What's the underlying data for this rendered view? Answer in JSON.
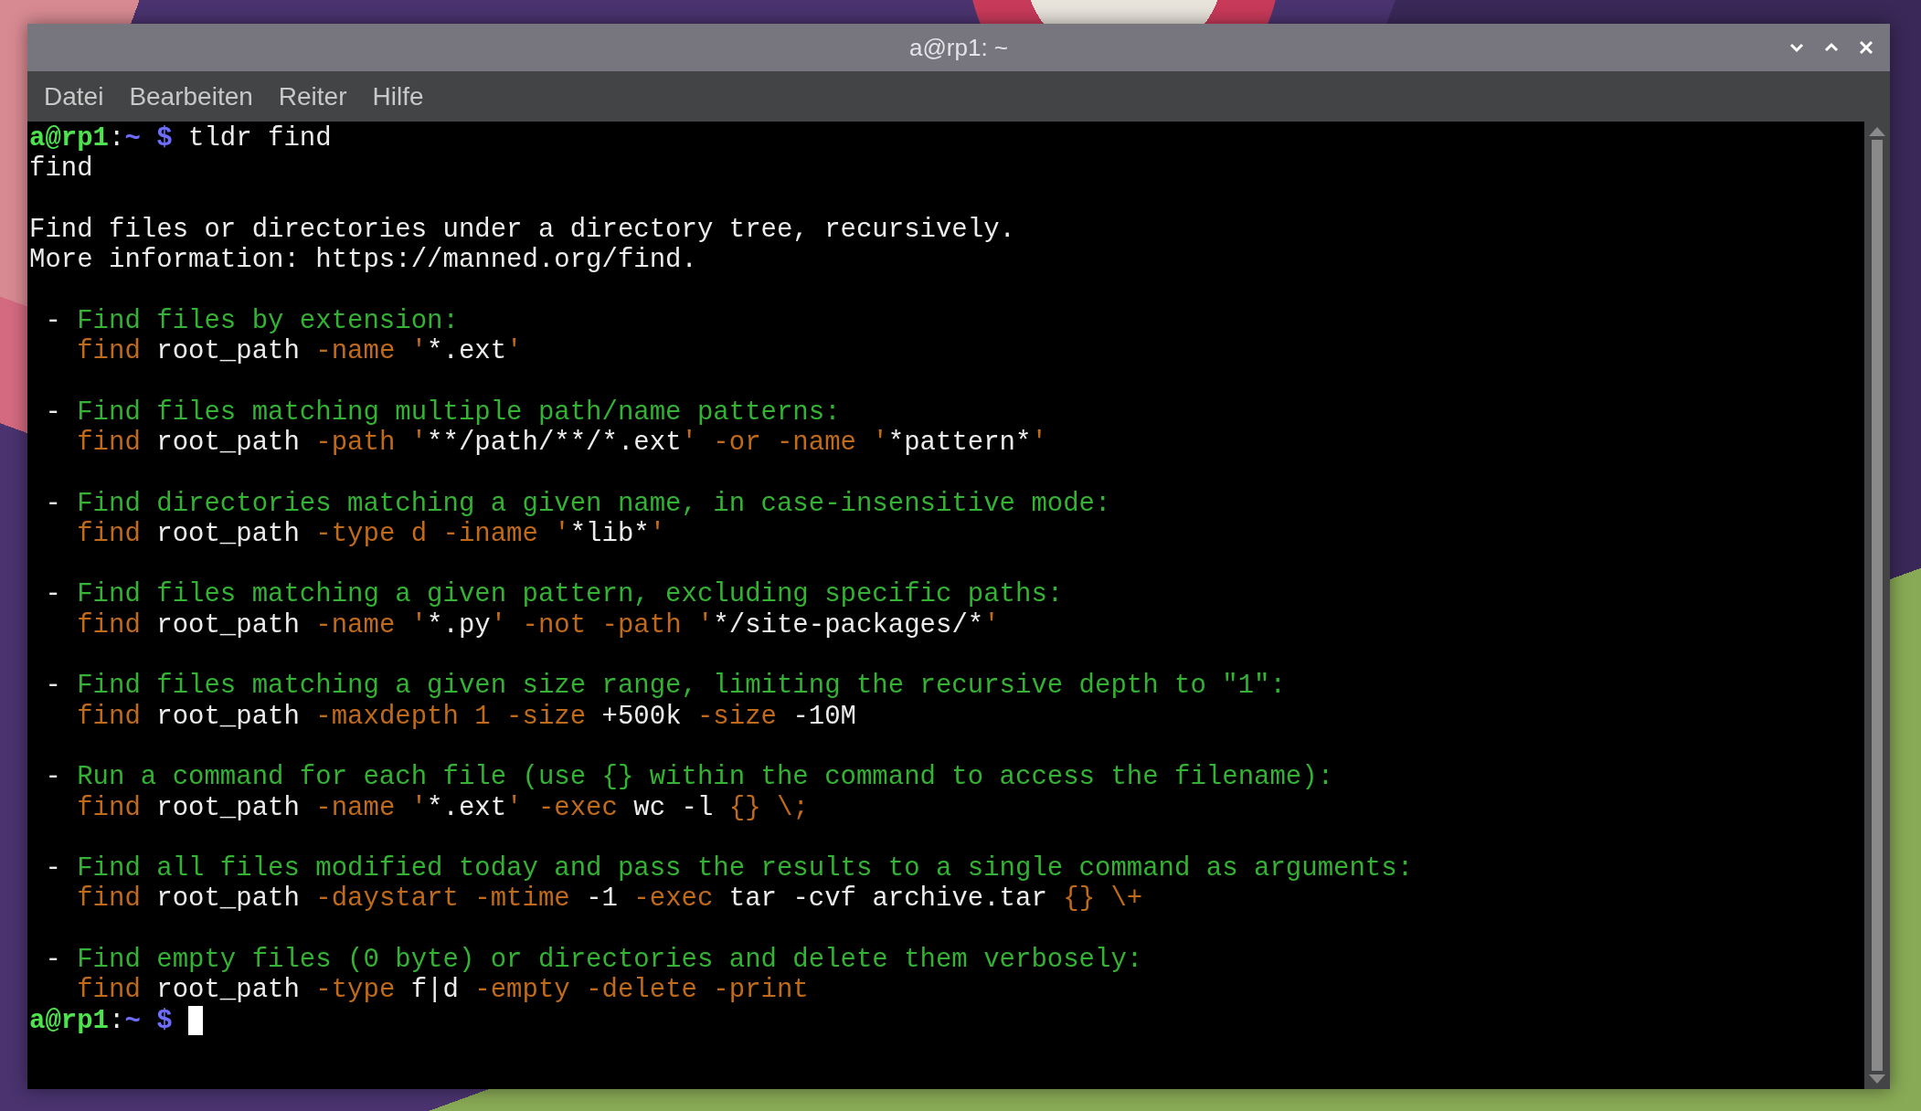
{
  "window": {
    "title": "a@rp1: ~"
  },
  "menu": [
    {
      "label": "Datei"
    },
    {
      "label": "Bearbeiten"
    },
    {
      "label": "Reiter"
    },
    {
      "label": "Hilfe"
    }
  ],
  "terminal": {
    "blocks": [
      {
        "lines": [
          [
            {
              "kind": "user",
              "text": "a@rp1"
            },
            {
              "kind": "plain",
              "text": ":"
            },
            {
              "kind": "path",
              "text": "~ $"
            },
            {
              "kind": "plain",
              "text": " tldr find"
            }
          ],
          [
            {
              "kind": "plain",
              "text": "find"
            }
          ]
        ]
      },
      {
        "lines": [
          [
            {
              "kind": "plain",
              "text": "Find files or directories under a directory tree, recursively."
            }
          ],
          [
            {
              "kind": "plain",
              "text": "More information: https://manned.org/find."
            }
          ]
        ]
      },
      {
        "lines": [
          [
            {
              "kind": "plain",
              "text": " - "
            },
            {
              "kind": "heading",
              "text": "Find files by extension:"
            }
          ],
          [
            {
              "kind": "option",
              "text": "   find "
            },
            {
              "kind": "plain",
              "text": "root_path "
            },
            {
              "kind": "option",
              "text": "-name '"
            },
            {
              "kind": "plain",
              "text": "*.ext"
            },
            {
              "kind": "option",
              "text": "'"
            }
          ]
        ]
      },
      {
        "lines": [
          [
            {
              "kind": "plain",
              "text": " - "
            },
            {
              "kind": "heading",
              "text": "Find files matching multiple path/name patterns:"
            }
          ],
          [
            {
              "kind": "option",
              "text": "   find "
            },
            {
              "kind": "plain",
              "text": "root_path "
            },
            {
              "kind": "option",
              "text": "-path '"
            },
            {
              "kind": "plain",
              "text": "**/path/**/*.ext"
            },
            {
              "kind": "option",
              "text": "' -or -name '"
            },
            {
              "kind": "plain",
              "text": "*pattern*"
            },
            {
              "kind": "option",
              "text": "'"
            }
          ]
        ]
      },
      {
        "lines": [
          [
            {
              "kind": "plain",
              "text": " - "
            },
            {
              "kind": "heading",
              "text": "Find directories matching a given name, in case-insensitive mode:"
            }
          ],
          [
            {
              "kind": "option",
              "text": "   find "
            },
            {
              "kind": "plain",
              "text": "root_path "
            },
            {
              "kind": "option",
              "text": "-type d -iname '"
            },
            {
              "kind": "plain",
              "text": "*lib*"
            },
            {
              "kind": "option",
              "text": "'"
            }
          ]
        ]
      },
      {
        "lines": [
          [
            {
              "kind": "plain",
              "text": " - "
            },
            {
              "kind": "heading",
              "text": "Find files matching a given pattern, excluding specific paths:"
            }
          ],
          [
            {
              "kind": "option",
              "text": "   find "
            },
            {
              "kind": "plain",
              "text": "root_path "
            },
            {
              "kind": "option",
              "text": "-name '"
            },
            {
              "kind": "plain",
              "text": "*.py"
            },
            {
              "kind": "option",
              "text": "' -not -path '"
            },
            {
              "kind": "plain",
              "text": "*/site-packages/*"
            },
            {
              "kind": "option",
              "text": "'"
            }
          ]
        ]
      },
      {
        "lines": [
          [
            {
              "kind": "plain",
              "text": " - "
            },
            {
              "kind": "heading",
              "text": "Find files matching a given size range, limiting the recursive depth to \"1\":"
            }
          ],
          [
            {
              "kind": "option",
              "text": "   find "
            },
            {
              "kind": "plain",
              "text": "root_path "
            },
            {
              "kind": "option",
              "text": "-maxdepth 1 -size "
            },
            {
              "kind": "plain",
              "text": "+500k "
            },
            {
              "kind": "option",
              "text": "-size "
            },
            {
              "kind": "plain",
              "text": "-10M"
            }
          ]
        ]
      },
      {
        "lines": [
          [
            {
              "kind": "plain",
              "text": " - "
            },
            {
              "kind": "heading",
              "text": "Run a command for each file (use {} within the command to access the filename):"
            }
          ],
          [
            {
              "kind": "option",
              "text": "   find "
            },
            {
              "kind": "plain",
              "text": "root_path "
            },
            {
              "kind": "option",
              "text": "-name '"
            },
            {
              "kind": "plain",
              "text": "*.ext"
            },
            {
              "kind": "option",
              "text": "' -exec "
            },
            {
              "kind": "plain",
              "text": "wc -l "
            },
            {
              "kind": "option",
              "text": "{} \\;"
            }
          ]
        ]
      },
      {
        "lines": [
          [
            {
              "kind": "plain",
              "text": " - "
            },
            {
              "kind": "heading",
              "text": "Find all files modified today and pass the results to a single command as arguments:"
            }
          ],
          [
            {
              "kind": "option",
              "text": "   find "
            },
            {
              "kind": "plain",
              "text": "root_path "
            },
            {
              "kind": "option",
              "text": "-daystart -mtime "
            },
            {
              "kind": "plain",
              "text": "-1 "
            },
            {
              "kind": "option",
              "text": "-exec "
            },
            {
              "kind": "plain",
              "text": "tar -cvf archive.tar "
            },
            {
              "kind": "option",
              "text": "{} \\+"
            }
          ]
        ]
      },
      {
        "lines": [
          [
            {
              "kind": "plain",
              "text": " - "
            },
            {
              "kind": "heading",
              "text": "Find empty files (0 byte) or directories and delete them verbosely:"
            }
          ],
          [
            {
              "kind": "option",
              "text": "   find "
            },
            {
              "kind": "plain",
              "text": "root_path "
            },
            {
              "kind": "option",
              "text": "-type "
            },
            {
              "kind": "plain",
              "text": "f|d "
            },
            {
              "kind": "option",
              "text": "-empty -delete -print"
            }
          ],
          [
            {
              "kind": "user",
              "text": "a@rp1"
            },
            {
              "kind": "plain",
              "text": ":"
            },
            {
              "kind": "path",
              "text": "~ $"
            }
          ]
        ]
      }
    ]
  }
}
